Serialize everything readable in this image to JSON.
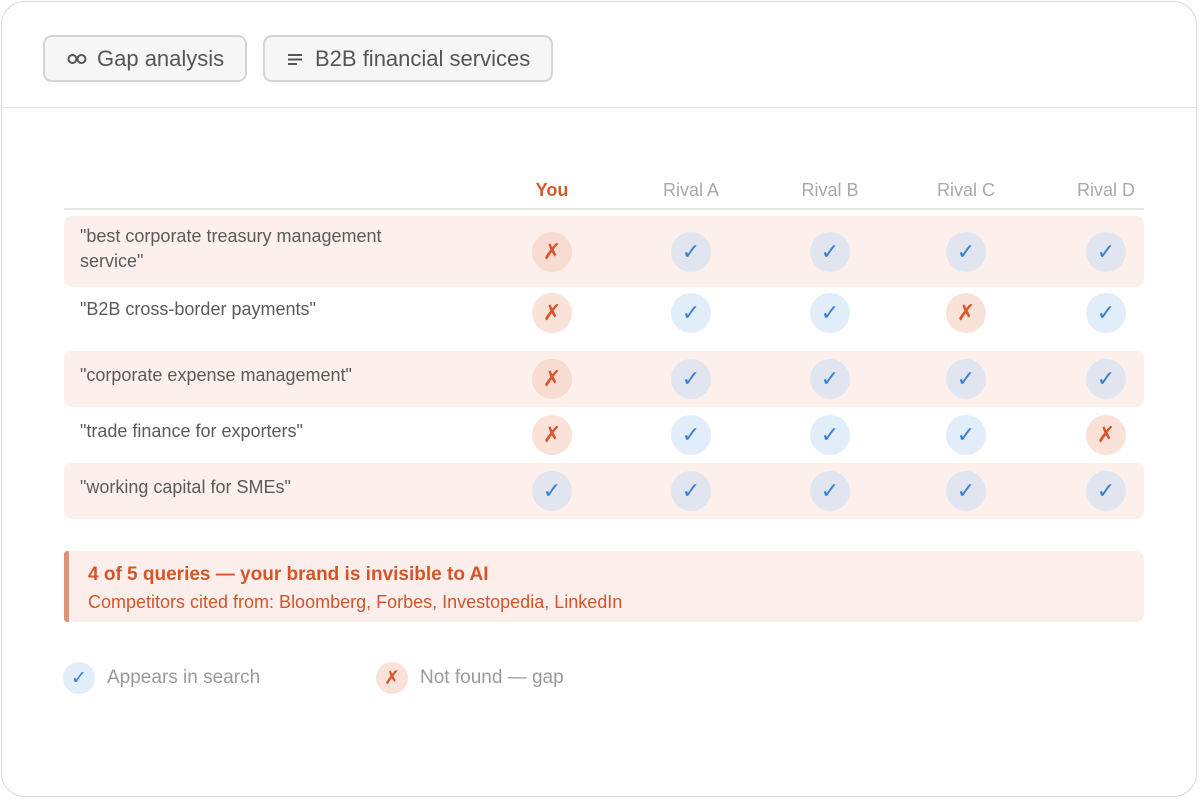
{
  "toolbar": {
    "chip1": {
      "label": "Gap analysis",
      "icon": "infinity-icon"
    },
    "chip2": {
      "label": "B2B financial services",
      "icon": "lines-icon"
    }
  },
  "table": {
    "columns": [
      "You",
      "Rival A",
      "Rival B",
      "Rival C",
      "Rival D"
    ],
    "rows": [
      {
        "query": "\"best corporate treasury management service\"",
        "results": [
          false,
          true,
          true,
          true,
          true
        ]
      },
      {
        "query": "\"B2B cross-border payments\"",
        "results": [
          false,
          true,
          true,
          false,
          true
        ]
      },
      {
        "query": "\"corporate expense management\"",
        "results": [
          false,
          true,
          true,
          true,
          true
        ]
      },
      {
        "query": "\"trade finance for exporters\"",
        "results": [
          false,
          true,
          true,
          true,
          false
        ]
      },
      {
        "query": "\"working capital for SMEs\"",
        "results": [
          true,
          true,
          true,
          true,
          true
        ]
      }
    ]
  },
  "symbols": {
    "yes": "✓",
    "no": "✗"
  },
  "alert": {
    "title": "4 of 5 queries — your brand is invisible to AI",
    "subtitle": "Competitors cited from: Bloomberg, Forbes, Investopedia, LinkedIn"
  },
  "legend": {
    "yes_label": "Appears in search",
    "no_label": "Not found — gap"
  },
  "colors": {
    "accent": "#d15a2c",
    "yes": "#3a7fd0",
    "no": "#d9542a",
    "row_highlight": "#fdf0ec"
  }
}
